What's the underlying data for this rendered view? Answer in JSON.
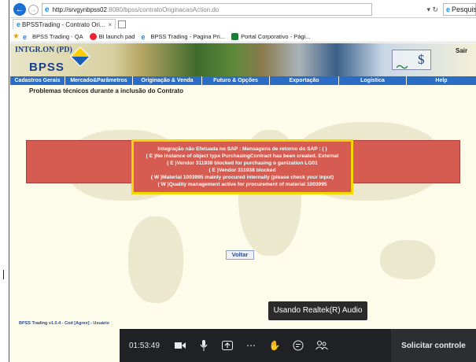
{
  "browser": {
    "url_host": "http://srvgynbpss02",
    "url_rest": ":8080/bpss/contratoOriginacaoAction.do",
    "search_placeholder": "Pesquisa",
    "tab_label": "BPSSTrading - Contrato Ori...",
    "tab_close": "×",
    "favorites": [
      {
        "label": "BPSS Trading - QA",
        "icon": "ie-e-icon"
      },
      {
        "label": "BI launch pad",
        "icon": "pin-icon"
      },
      {
        "label": "BPSS Trading - Pagina Pri...",
        "icon": "ie-e-icon"
      },
      {
        "label": "Portal Corporativo - Pági...",
        "icon": "portal-icon"
      }
    ]
  },
  "app": {
    "brand_small": "INTGR.ON (PD)",
    "brand_logo": "BPSS",
    "logout": "Sair",
    "menu": [
      "Cadastros Gerais",
      "Mercado&Parâmetros",
      "Originação & Venda",
      "Futuro & Opções",
      "Exportação",
      "Logística",
      "Help"
    ],
    "page_title": "Problemas técnicos durante a inclusão do Contrato",
    "error_lines": [
      "Integração não Efetuada no SAP : Mensagens de retorno do SAP : ( )",
      "( E )No instance of object type PurchasingContract has been created. External",
      "( E )Vendor 311938 blocked for purchasing o ganization LG01",
      "( E )Vendor 311938 blocked",
      "( W )Material 1003995 mainly procured internally (please check your input)",
      "( W )Quality management active for procurement of material 1003995"
    ],
    "back_button": "Voltar",
    "status_text": "BPSS Trading v1.0.4 - Cod [Agrex] - Usuário"
  },
  "meet": {
    "tooltip": "Usando Realtek(R) Audio",
    "time": "01:53:49",
    "request_control": "Solicitar controle"
  },
  "colors": {
    "menu_blue": "#2b6cc4",
    "error_red": "#d65b50",
    "highlight_yellow": "#f4d600",
    "meet_dark": "#202124"
  }
}
